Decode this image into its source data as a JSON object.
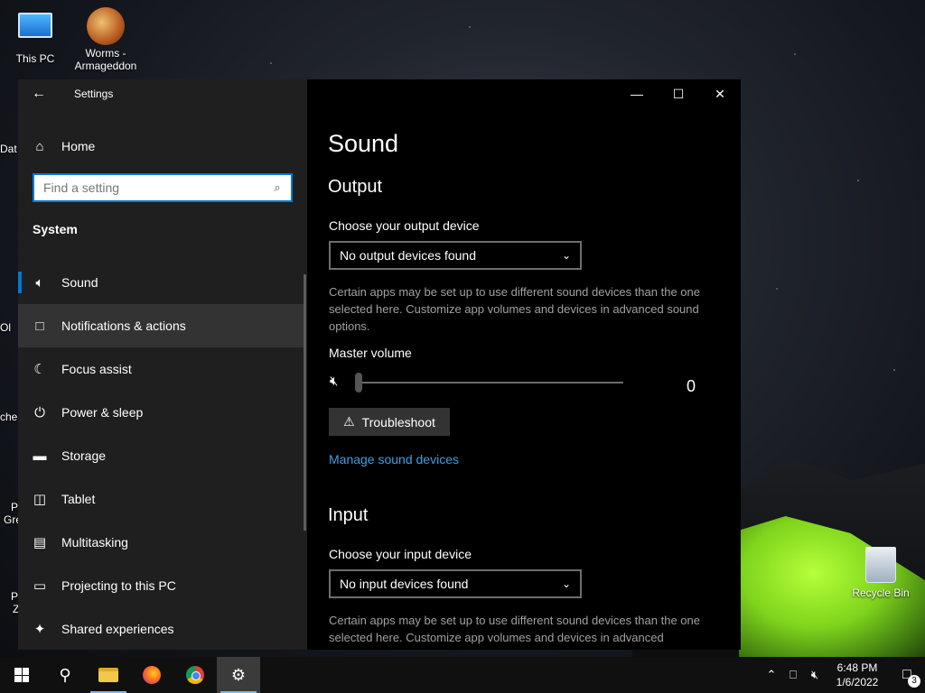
{
  "desktop": {
    "icons": {
      "this_pc": "This PC",
      "worms_line1": "Worms -",
      "worms_line2": "Armageddon",
      "recycle_bin": "Recycle Bin"
    },
    "edge_labels": [
      "Dat",
      "Ol",
      "che",
      "P",
      "Gre",
      "P",
      "Z"
    ]
  },
  "window": {
    "title": "Settings",
    "controls": {
      "minimize": "—",
      "maximize": "☐",
      "close": "✕"
    }
  },
  "sidebar": {
    "home_label": "Home",
    "search": {
      "placeholder": "Find a setting",
      "value": ""
    },
    "section_title": "System",
    "items": [
      {
        "label": "Sound",
        "icon": "speaker-icon",
        "selected": true
      },
      {
        "label": "Notifications & actions",
        "icon": "message-icon",
        "hover": true
      },
      {
        "label": "Focus assist",
        "icon": "moon-icon"
      },
      {
        "label": "Power & sleep",
        "icon": "power-icon"
      },
      {
        "label": "Storage",
        "icon": "drive-icon"
      },
      {
        "label": "Tablet",
        "icon": "tablet-icon"
      },
      {
        "label": "Multitasking",
        "icon": "multitasking-icon"
      },
      {
        "label": "Projecting to this PC",
        "icon": "projecting-icon"
      },
      {
        "label": "Shared experiences",
        "icon": "shared-icon"
      }
    ]
  },
  "content": {
    "page_title": "Sound",
    "output": {
      "heading": "Output",
      "device_label": "Choose your output device",
      "device_value": "No output devices found",
      "description": "Certain apps may be set up to use different sound devices than the one selected here. Customize app volumes and devices in advanced sound options.",
      "master_volume_label": "Master volume",
      "volume_value": "0",
      "troubleshoot_label": "Troubleshoot",
      "manage_link": "Manage sound devices"
    },
    "input": {
      "heading": "Input",
      "device_label": "Choose your input device",
      "device_value": "No input devices found",
      "description": "Certain apps may be set up to use different sound devices than the one selected here. Customize app volumes and devices in advanced"
    }
  },
  "taskbar": {
    "apps": [
      "start-icon",
      "search-icon",
      "file-explorer-icon",
      "firefox-icon",
      "chrome-icon",
      "settings-icon"
    ],
    "clock_time": "6:48 PM",
    "clock_date": "1/6/2022",
    "notification_count": "3"
  }
}
